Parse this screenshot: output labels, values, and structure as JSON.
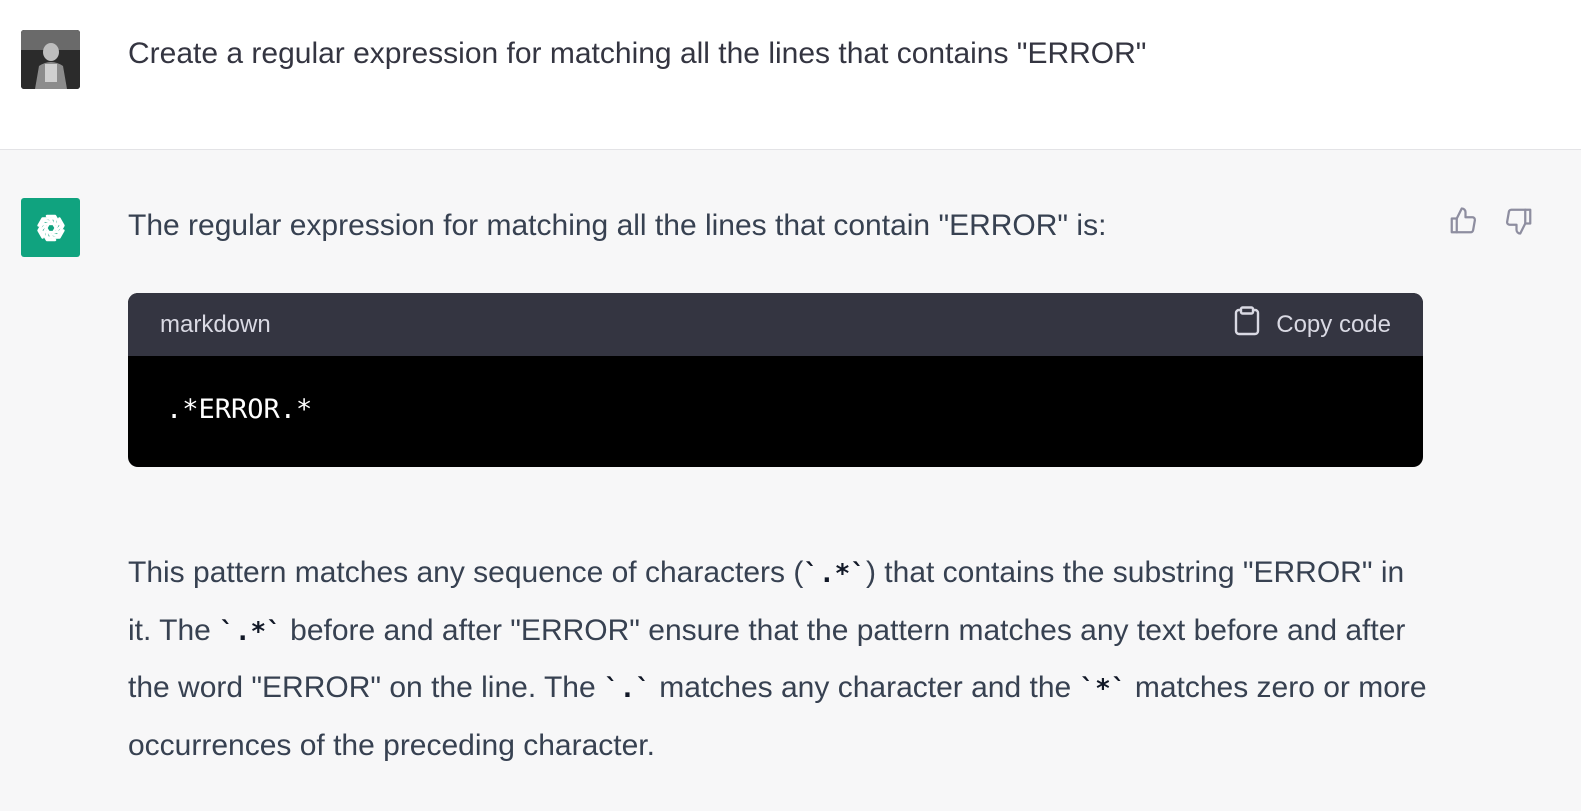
{
  "user_message": {
    "text": "Create a regular expression for matching all the lines that contains \"ERROR\""
  },
  "assistant_message": {
    "intro": "The regular expression for matching all the lines that contain \"ERROR\" is:",
    "code_block": {
      "language": "markdown",
      "copy_label": "Copy code",
      "code": ".*ERROR.*"
    },
    "explanation": [
      {
        "t": "text",
        "v": "This pattern matches any sequence of characters ("
      },
      {
        "t": "code",
        "v": "`.*`"
      },
      {
        "t": "text",
        "v": ") that contains the substring \"ERROR\" in it. The "
      },
      {
        "t": "code",
        "v": "`.*`"
      },
      {
        "t": "text",
        "v": " before and after \"ERROR\" ensure that the pattern matches any text before and after the word \"ERROR\" on the line. The "
      },
      {
        "t": "code",
        "v": "`.`"
      },
      {
        "t": "text",
        "v": " matches any character and the "
      },
      {
        "t": "code",
        "v": "`*`"
      },
      {
        "t": "text",
        "v": " matches zero or more occurrences of the preceding character."
      }
    ]
  },
  "icons": {
    "user_avatar": "user-avatar-photo",
    "assistant_avatar": "openai-logo-icon",
    "thumbs_up": "thumbs-up-icon",
    "thumbs_down": "thumbs-down-icon",
    "copy": "clipboard-icon"
  },
  "colors": {
    "assistant_bg": "#f7f7f8",
    "bot_avatar_bg": "#10a37f",
    "code_header_bg": "#343541",
    "code_body_bg": "#000000"
  }
}
